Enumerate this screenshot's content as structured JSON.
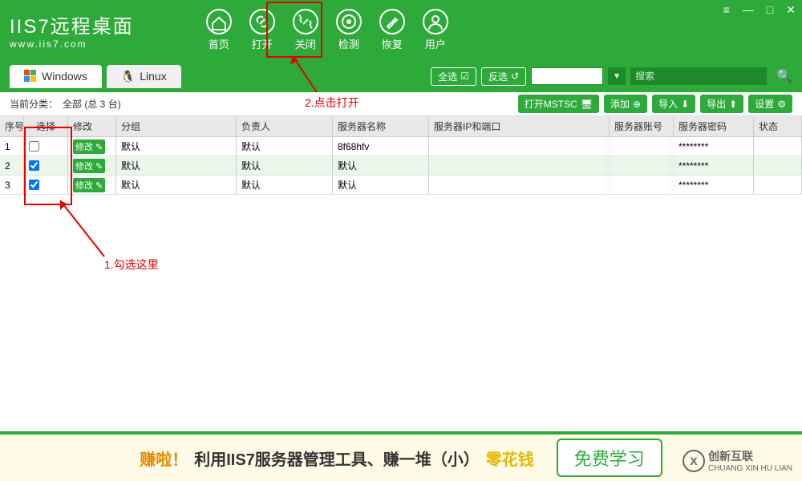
{
  "app": {
    "title": "IIS7远程桌面",
    "url": "www.iis7.com"
  },
  "nav": [
    {
      "label": "首页",
      "name": "home"
    },
    {
      "label": "打开",
      "name": "open"
    },
    {
      "label": "关闭",
      "name": "close"
    },
    {
      "label": "检测",
      "name": "detect"
    },
    {
      "label": "恢复",
      "name": "restore"
    },
    {
      "label": "用户",
      "name": "user"
    }
  ],
  "tabs": {
    "windows": "Windows",
    "linux": "Linux"
  },
  "toolbar": {
    "select_all": "全选",
    "invert": "反选",
    "search_ph": "搜索"
  },
  "subbar": {
    "label": "当前分类：",
    "value": "全部 (总 3 台)",
    "open_mstsc": "打开MSTSC",
    "add": "添加",
    "import": "导入",
    "export": "导出",
    "settings": "设置"
  },
  "columns": {
    "seq": "序号",
    "sel": "选择",
    "mod": "修改",
    "group": "分组",
    "owner": "负责人",
    "name": "服务器名称",
    "ip": "服务器IP和端口",
    "acct": "服务器账号",
    "pwd": "服务器密码",
    "status": "状态"
  },
  "mod_label": "修改",
  "rows": [
    {
      "seq": "1",
      "checked": false,
      "group": "默认",
      "owner": "默认",
      "name": "8f68hfv",
      "ip": "",
      "acct": "",
      "pwd": "********"
    },
    {
      "seq": "2",
      "checked": true,
      "group": "默认",
      "owner": "默认",
      "name": "默认",
      "ip": "",
      "acct": "",
      "pwd": "********"
    },
    {
      "seq": "3",
      "checked": true,
      "group": "默认",
      "owner": "默认",
      "name": "默认",
      "ip": "",
      "acct": "",
      "pwd": "********"
    }
  ],
  "annotations": {
    "a1": "1.勾选这里",
    "a2": "2.点击打开"
  },
  "footer": {
    "p1": "赚啦！",
    "p2": "利用IIS7服务器管理工具、赚一堆（小）",
    "p3": "零花钱",
    "learn": "免费学习"
  },
  "watermark": {
    "brand": "创新互联",
    "sub": "CHUANG XIN HU LIAN",
    "logo": "X"
  }
}
